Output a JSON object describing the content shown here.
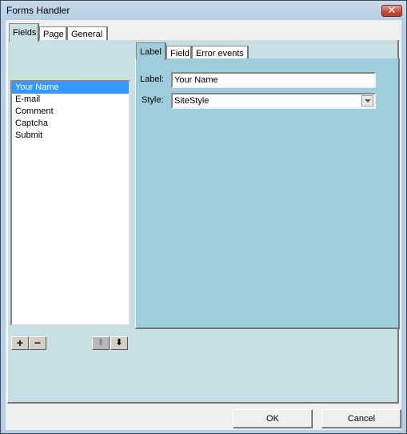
{
  "window": {
    "title": "Forms Handler",
    "close_icon": "close-icon"
  },
  "outer_tabs": [
    {
      "label": "Fields",
      "active": true
    },
    {
      "label": "Page",
      "active": false
    },
    {
      "label": "General",
      "active": false
    }
  ],
  "fields_list": {
    "items": [
      "Your Name",
      "E-mail",
      "Comment",
      "Captcha",
      "Submit"
    ],
    "selected": "Your Name"
  },
  "list_buttons": {
    "add": {
      "icon": "plus-icon",
      "glyph": "+"
    },
    "remove": {
      "icon": "minus-icon",
      "glyph": "−"
    },
    "move_up": {
      "icon": "arrow-up-icon",
      "glyph": "⬆",
      "enabled": false
    },
    "move_down": {
      "icon": "arrow-down-icon",
      "glyph": "⬇",
      "enabled": true
    }
  },
  "inner_tabs": [
    {
      "label": "Label",
      "active": true
    },
    {
      "label": "Field",
      "active": false
    },
    {
      "label": "Error events",
      "active": false
    }
  ],
  "label_tab": {
    "label_caption": "Label:",
    "label_value": "Your Name",
    "style_caption": "Style:",
    "style_value": "SiteStyle"
  },
  "buttons": {
    "ok": "OK",
    "cancel": "Cancel"
  },
  "colors": {
    "selection": "#3399ff",
    "outer_panel": "#c8dfe4",
    "inner_panel": "#9ecddc"
  }
}
